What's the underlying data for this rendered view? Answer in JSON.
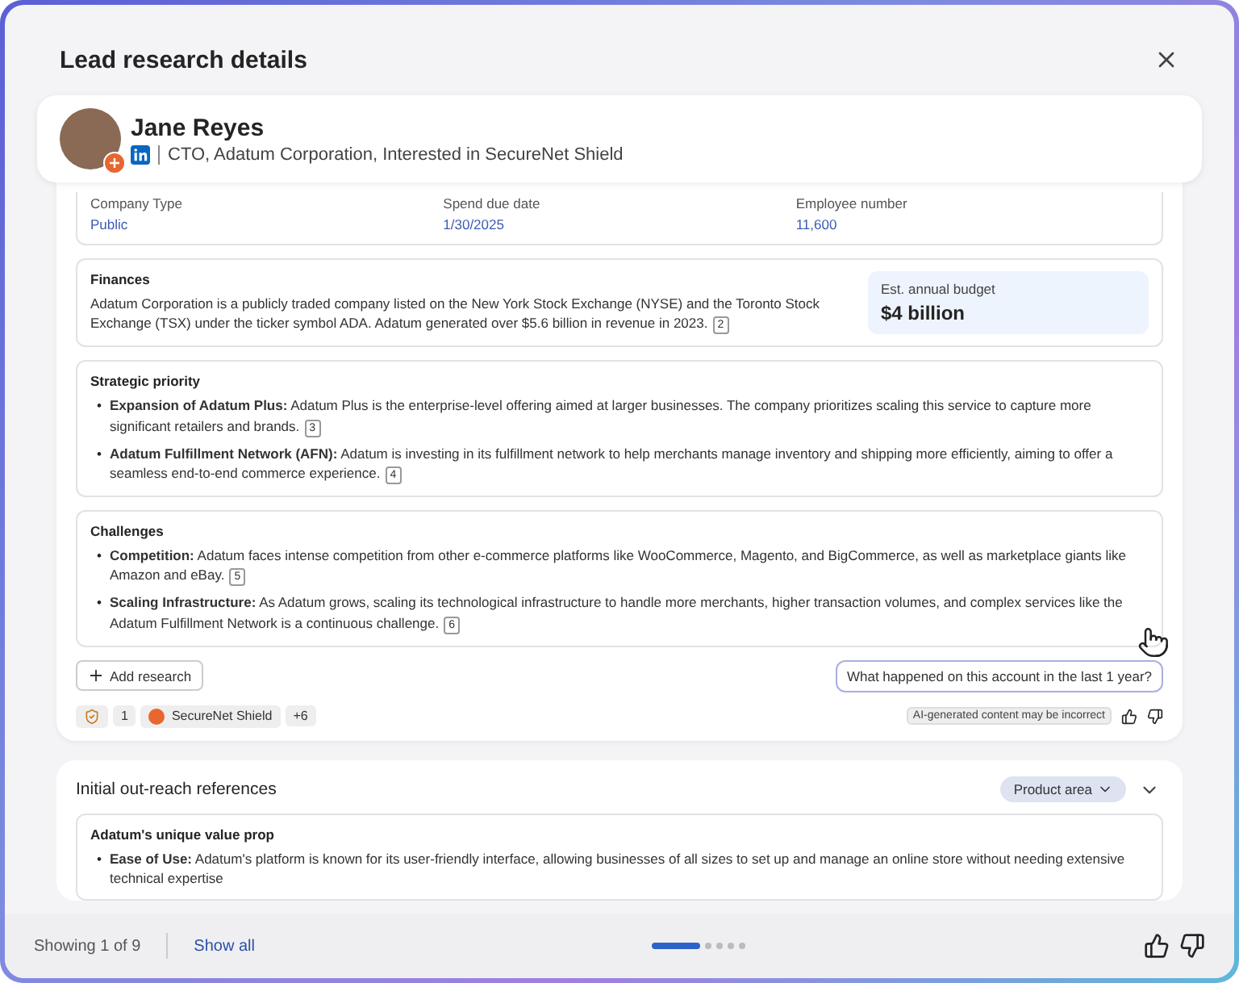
{
  "dialog": {
    "title": "Lead research details"
  },
  "profile": {
    "name": "Jane Reyes",
    "subtitle": "CTO, Adatum Corporation, Interested in SecureNet Shield"
  },
  "fields": [
    {
      "label": "Company Type",
      "value": "Public"
    },
    {
      "label": "Spend due date",
      "value": "1/30/2025"
    },
    {
      "label": "Employee number",
      "value": "11,600"
    }
  ],
  "finances": {
    "title": "Finances",
    "text": "Adatum Corporation is a publicly traded company listed on the New York Stock Exchange (NYSE) and the Toronto Stock Exchange (TSX) under the ticker symbol ADA. Adatum generated over $5.6 billion in revenue in 2023.",
    "citation": "2",
    "budget_label": "Est. annual budget",
    "budget_value": "$4 billion"
  },
  "sections": [
    {
      "title": "Strategic priority",
      "bullets": [
        {
          "marker": "•",
          "text": "**Expansion of Adatum Plus:** Adatum Plus is the enterprise-level offering aimed at larger businesses. The company prioritizes scaling this service to capture more significant retailers and brands.",
          "citation": "3"
        },
        {
          "marker": "•",
          "text": "**Adatum Fulfillment Network (AFN):** Adatum is investing in its fulfillment network to help merchants manage inventory and shipping more efficiently, aiming to offer a seamless end-to-end commerce experience.",
          "citation": "4"
        }
      ]
    },
    {
      "title": "Challenges",
      "bullets": [
        {
          "marker": "•",
          "text": "**Competition:** Adatum faces intense competition from other e-commerce platforms like WooCommerce, Magento, and BigCommerce, as well as marketplace giants like Amazon and eBay.",
          "citation": "5"
        },
        {
          "marker": "•",
          "text": "**Scaling Infrastructure:** As Adatum grows, scaling its technological infrastructure to handle more merchants, higher transaction volumes, and complex services like the Adatum Fulfillment Network is a continuous challenge.",
          "citation": "6"
        }
      ]
    }
  ],
  "add_research": "Add research",
  "suggestion": "What happened on this account in the last 1 year?",
  "sources": {
    "count": "1",
    "name": "SecureNet Shield",
    "more": "+6"
  },
  "disclaimer": "AI-generated content may be incorrect",
  "outreach": {
    "title": "Initial out-reach references",
    "filter": "Product area",
    "subsection": {
      "title": "Adatum's unique value prop",
      "bullets": [
        {
          "marker": "•",
          "text": "**Ease of Use:** Adatum's platform is known for its user-friendly interface, allowing businesses of all sizes to set up and manage an online store without needing extensive technical expertise"
        }
      ]
    }
  },
  "footer": {
    "showing": "Showing 1 of 9",
    "show_all": "Show all",
    "pages": [
      {
        "selected": true
      },
      {
        "selected": false
      },
      {
        "selected": false
      },
      {
        "selected": false
      },
      {
        "selected": false
      }
    ]
  }
}
